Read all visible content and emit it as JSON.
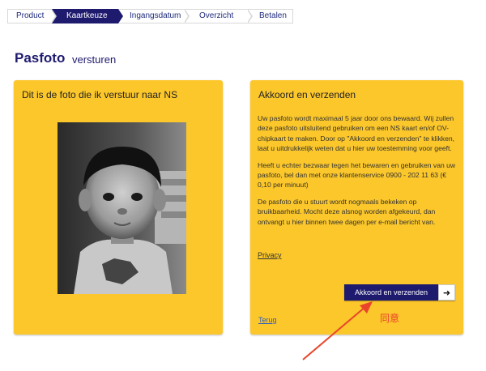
{
  "steps": [
    {
      "label": "Product",
      "active": false
    },
    {
      "label": "Kaartkeuze",
      "active": true
    },
    {
      "label": "Ingangsdatum",
      "active": false
    },
    {
      "label": "Overzicht",
      "active": false
    },
    {
      "label": "Betalen",
      "active": false
    }
  ],
  "header": {
    "title": "Pasfoto",
    "subtitle": "versturen"
  },
  "left_panel": {
    "heading": "Dit is de foto die ik verstuur naar NS"
  },
  "right_panel": {
    "heading": "Akkoord en verzenden",
    "paragraphs": [
      "Uw pasfoto wordt maximaal 5 jaar door ons bewaard. Wij zullen deze pasfoto uitsluitend gebruiken om een NS kaart en/of OV-chipkaart te maken. Door op \"Akkoord en verzenden\" te klikken, laat u uitdrukkelijk weten dat u hier uw toestemming voor geeft.",
      "Heeft u echter bezwaar tegen het bewaren en gebruiken van uw pasfoto, bel dan met onze klantenservice 0900 - 202 11 63 (€ 0,10 per minuut)",
      "De pasfoto die u stuurt wordt nogmaals bekeken op bruikbaarheid. Mocht deze alsnog worden afgekeurd, dan ontvangt u hier binnen twee dagen per e-mail bericht van."
    ],
    "privacy_link": "Privacy",
    "agree_button": "Akkoord en verzenden",
    "back_link": "Terug"
  },
  "annotation": {
    "text": "同意"
  },
  "colors": {
    "brand_blue": "#1e1a6e",
    "panel_yellow": "#fcc72a",
    "annotation_red": "#e8452a"
  }
}
